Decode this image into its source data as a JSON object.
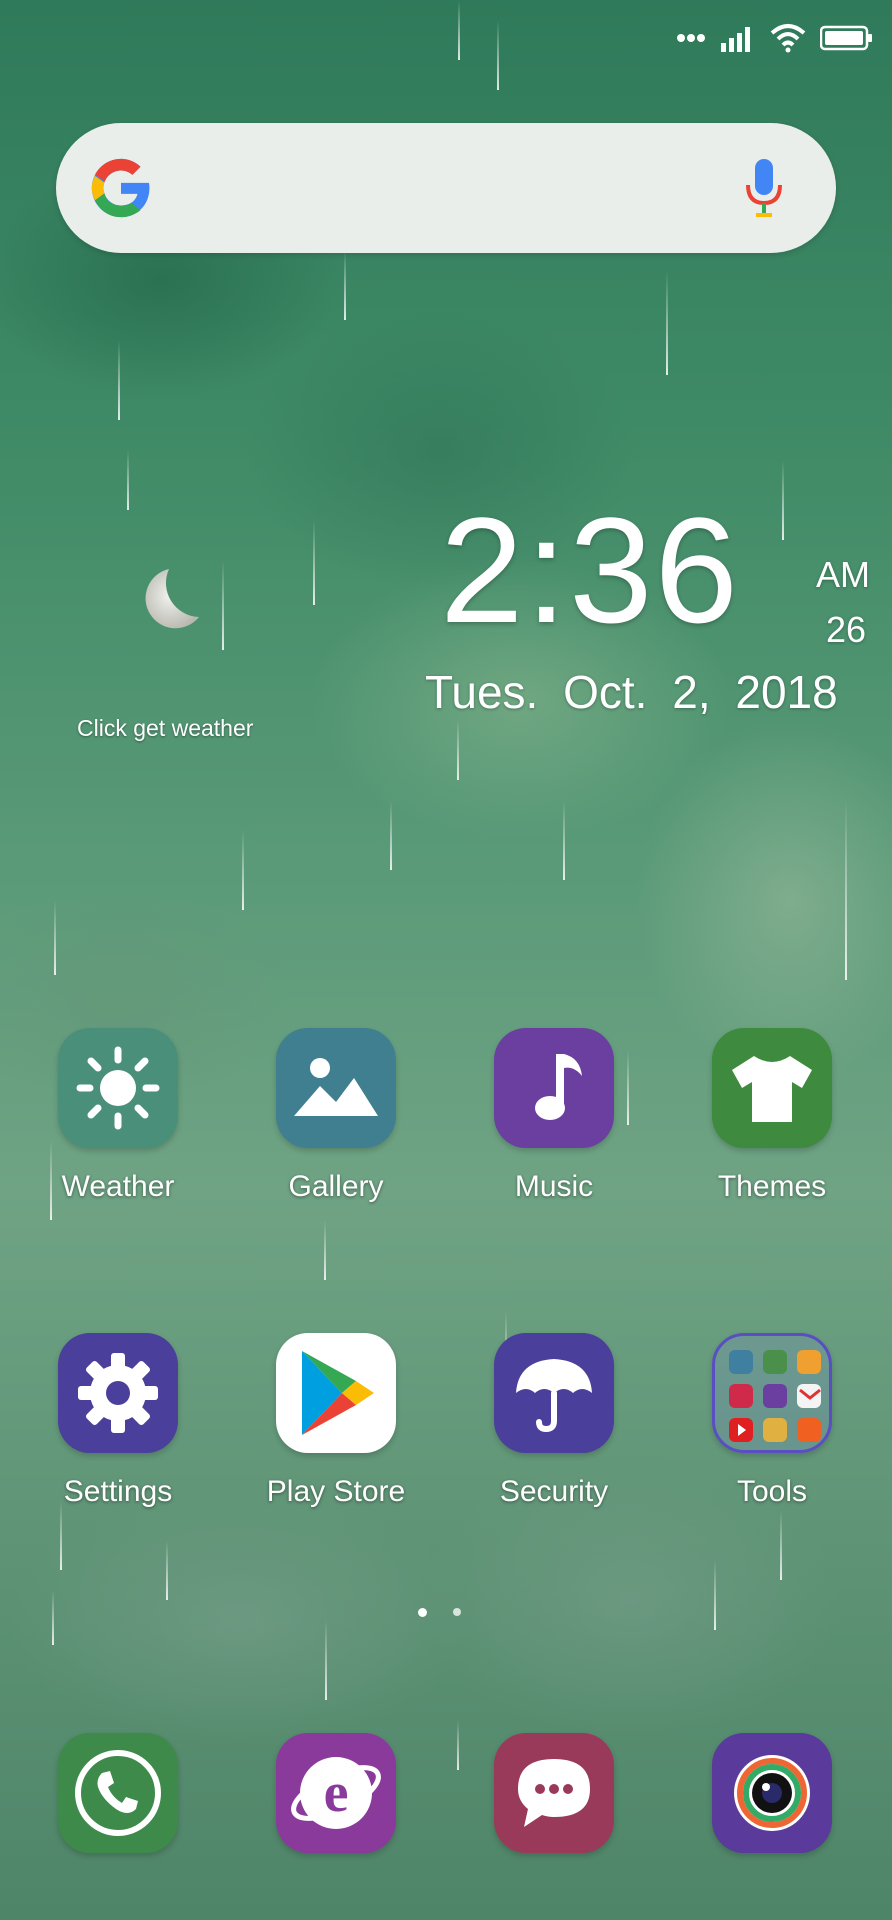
{
  "status_bar": {
    "icons": [
      "more-dots-icon",
      "signal-icon",
      "wifi-icon",
      "battery-icon"
    ]
  },
  "search_widget": {
    "logo": "google-logo-icon",
    "voice": "microphone-icon"
  },
  "clock_widget": {
    "time": "2:36",
    "ampm": "AM",
    "seconds": "26",
    "date": "Tues.  Oct. 2,  2018",
    "weather_prompt": "Click get weather",
    "weather_icon": "moon-icon"
  },
  "apps_row1": [
    {
      "label": "Weather",
      "icon": "sun-icon",
      "color": "#4a8f7a"
    },
    {
      "label": "Gallery",
      "icon": "image-icon",
      "color": "#3f7f8f"
    },
    {
      "label": "Music",
      "icon": "music-note-icon",
      "color": "#6b3fa0"
    },
    {
      "label": "Themes",
      "icon": "tshirt-icon",
      "color": "#3e8a3e"
    }
  ],
  "apps_row2": [
    {
      "label": "Settings",
      "icon": "gear-icon",
      "color": "#4a3f9a"
    },
    {
      "label": "Play Store",
      "icon": "play-store-icon",
      "color": "#ffffff"
    },
    {
      "label": "Security",
      "icon": "umbrella-icon",
      "color": "#4a3f9a"
    },
    {
      "label": "Tools",
      "icon": "folder-icon",
      "color": "#5a4fc0"
    }
  ],
  "page_indicator": {
    "pages": 2,
    "current": 1
  },
  "dock": [
    {
      "name": "phone",
      "icon": "phone-icon",
      "color": "#3e8a4a"
    },
    {
      "name": "browser",
      "icon": "browser-icon",
      "color": "#8a3a9a"
    },
    {
      "name": "messages",
      "icon": "chat-bubble-icon",
      "color": "#9a3a5a"
    },
    {
      "name": "camera",
      "icon": "camera-icon",
      "color": "#5a3a9a"
    }
  ]
}
